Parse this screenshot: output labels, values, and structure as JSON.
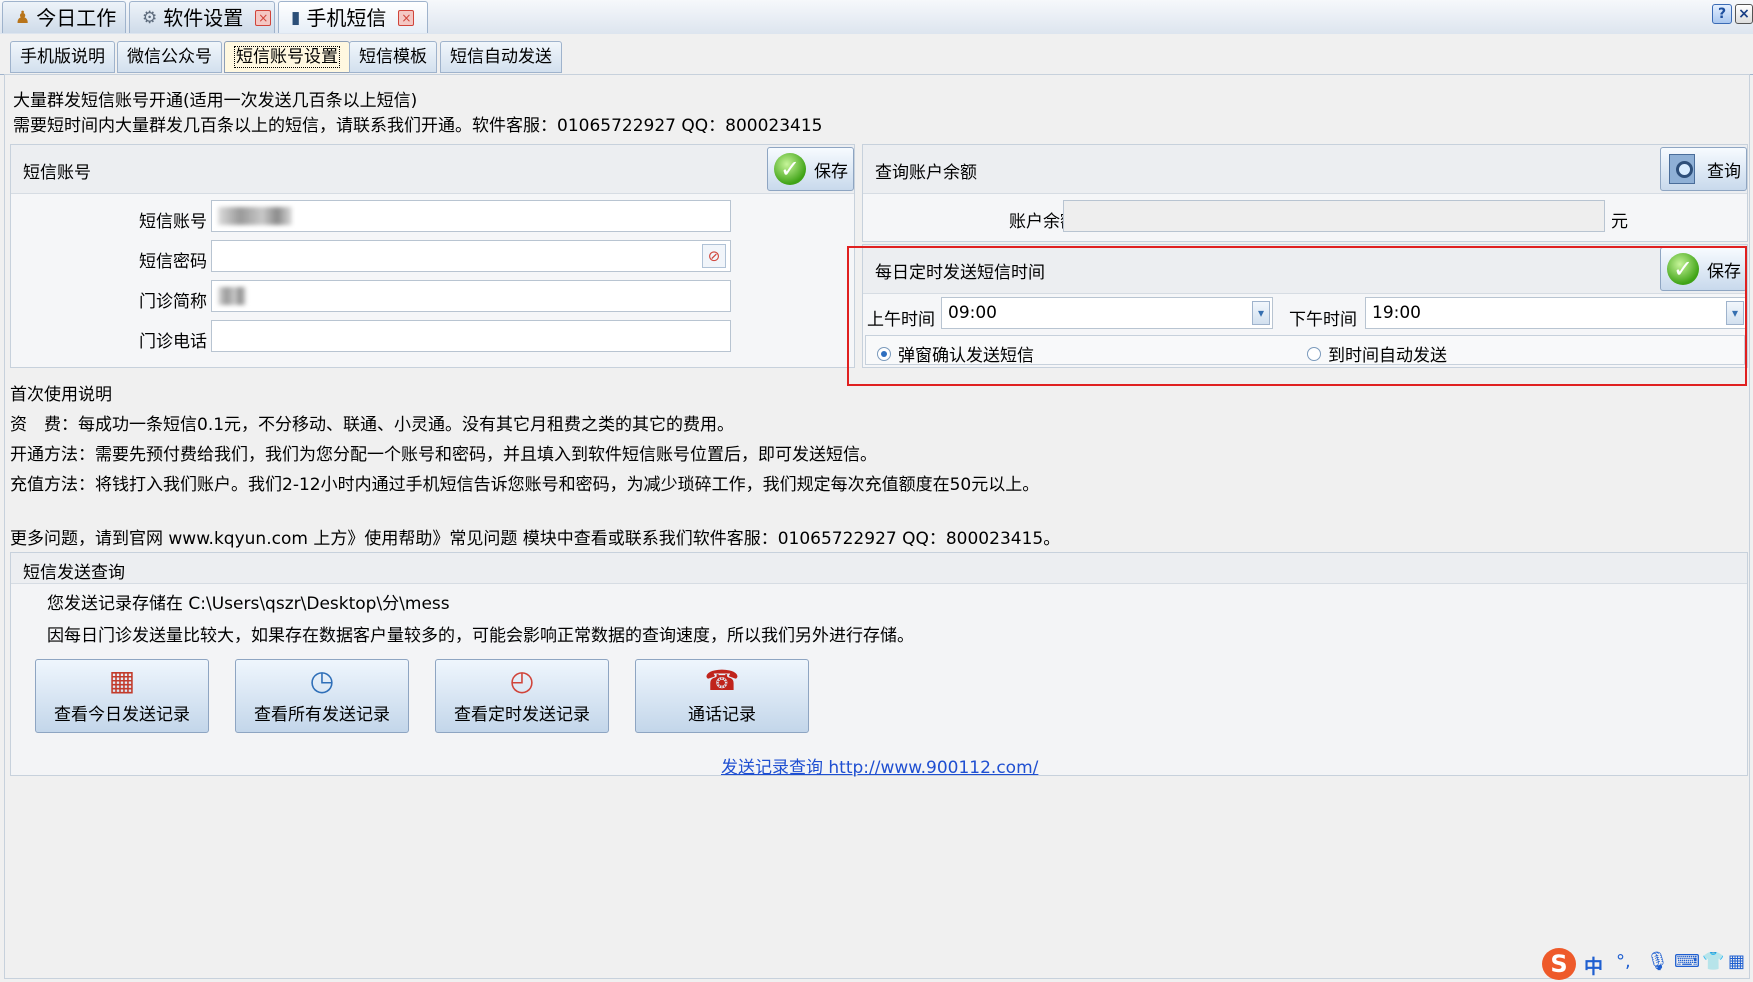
{
  "doc_tabs": [
    {
      "label": "今日工作",
      "icon": "worker-icon",
      "closable": false
    },
    {
      "label": "软件设置",
      "icon": "gears-icon",
      "closable": true
    },
    {
      "label": "手机短信",
      "icon": "mobile-phone-icon",
      "closable": true
    }
  ],
  "window_controls": {
    "help": "?",
    "close": "×"
  },
  "sub_tabs": [
    "手机版说明",
    "微信公众号",
    "短信账号设置",
    "短信模板",
    "短信自动发送"
  ],
  "intro": {
    "line1": "大量群发短信账号开通(适用一次发送几百条以上短信)",
    "line2": "需要短时间内大量群发几百条以上的短信，请联系我们开通。软件客服：01065722927 QQ：800023415"
  },
  "account_panel": {
    "title": "短信账号",
    "save_label": "保存",
    "account_label": "短信账号",
    "password_label": "短信密码",
    "clinic_name_label": "门诊简称",
    "clinic_phone_label": "门诊电话",
    "account_value": "",
    "password_value": "",
    "clinic_name_value": "",
    "clinic_phone_value": ""
  },
  "balance_panel": {
    "title": "查询账户余额",
    "query_label": "查询",
    "balance_label": "账户余额",
    "balance_value": "",
    "unit": "元"
  },
  "schedule_panel": {
    "title": "每日定时发送短信时间",
    "save_label": "保存",
    "am_label": "上午时间",
    "am_value": "09:00",
    "pm_label": "下午时间",
    "pm_value": "19:00",
    "radio_confirm": "弹窗确认发送短信",
    "radio_auto": "到时间自动发送",
    "selected": "confirm",
    "highlight_color": "#e02020"
  },
  "instructions": {
    "heading": "首次使用说明",
    "fee": "资　费：每成功一条短信0.1元，不分移动、联通、小灵通。没有其它月租费之类的其它的费用。",
    "open": "开通方法：需要先预付费给我们，我们为您分配一个账号和密码，并且填入到软件短信账号位置后，即可发送短信。",
    "recharge": "充值方法：将钱打入我们账户。我们2-12小时内通过手机短信告诉您账号和密码，为减少琐碎工作，我们规定每次充值额度在50元以上。",
    "more": "更多问题，请到官网 www.kqyun.com 上方》使用帮助》常见问题 模块中查看或联系我们软件客服：01065722927 QQ：800023415。"
  },
  "query_panel": {
    "title": "短信发送查询",
    "path_text": "您发送记录存储在 C:\\Users\\qszr\\Desktop\\分\\mess",
    "note": "因每日门诊发送量比较大，如果存在数据客户量较多的，可能会影响正常数据的查询速度，所以我们另外进行存储。",
    "buttons": [
      {
        "label": "查看今日发送记录",
        "icon": "calendar-icon"
      },
      {
        "label": "查看所有发送记录",
        "icon": "history-clock-icon"
      },
      {
        "label": "查看定时发送记录",
        "icon": "alarm-clock-icon"
      },
      {
        "label": "通话记录",
        "icon": "telephone-icon"
      }
    ],
    "link": "发送记录查询 http://www.900112.com/"
  },
  "tray": {
    "ime": "S",
    "lang": "中",
    "items": [
      "punct-icon",
      "mic-icon",
      "keyboard-icon",
      "shirt-icon",
      "grid-icon"
    ]
  }
}
